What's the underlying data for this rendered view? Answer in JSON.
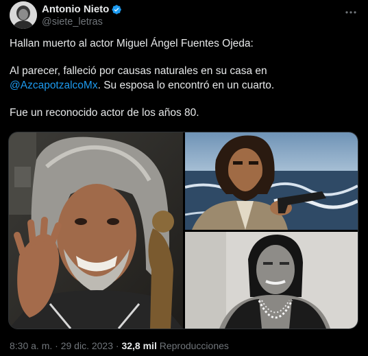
{
  "author": {
    "display_name": "Antonio Nieto",
    "handle": "@siete_letras",
    "verified": true
  },
  "tweet": {
    "line1": "Hallan muerto al actor Miguel Ángel Fuentes Ojeda:",
    "line2_prefix": "Al parecer, falleció por causas naturales en su casa en",
    "mention": "@AzcapotzalcoMx",
    "line2_suffix": ". Su esposa lo encontró en un cuarto.",
    "line3": "Fue un reconocido actor de los años 80."
  },
  "meta": {
    "time": "8:30 a. m.",
    "separator1": " · ",
    "date": "29 dic. 2023",
    "separator2": " · ",
    "views_count": "32,8 mil",
    "views_label": " Reproducciones"
  },
  "icons": {
    "verified": "verified-badge-icon",
    "more": "more-options-icon"
  },
  "colors": {
    "background": "#000000",
    "text": "#e7e9ea",
    "secondary_text": "#71767b",
    "accent": "#1d9bf0"
  }
}
